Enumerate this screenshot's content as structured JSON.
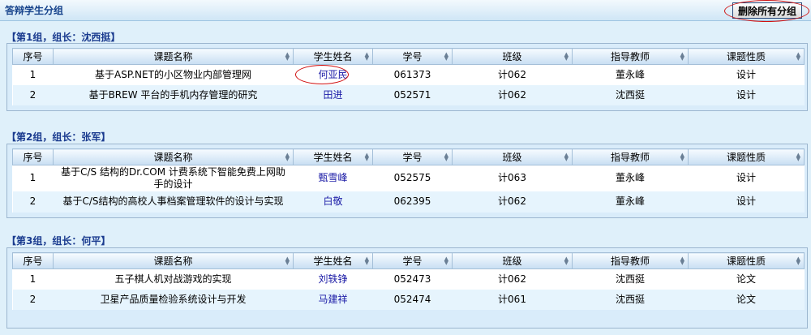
{
  "header": {
    "title": "答辩学生分组",
    "delete_all_label": "删除所有分组"
  },
  "columns": [
    "序号",
    "课题名称",
    "学生姓名",
    "学号",
    "班级",
    "指导教师",
    "课题性质"
  ],
  "groups": [
    {
      "title": "【第1组，组长：沈西挺】",
      "rows": [
        {
          "no": "1",
          "topic": "基于ASP.NET的小区物业内部管理网",
          "student": "何亚民",
          "id": "061373",
          "class": "计062",
          "teacher": "董永峰",
          "nature": "设计"
        },
        {
          "no": "2",
          "topic": "基于BREW 平台的手机内存管理的研究",
          "student": "田进",
          "id": "052571",
          "class": "计062",
          "teacher": "沈西挺",
          "nature": "设计"
        }
      ]
    },
    {
      "title": "【第2组，组长：张军】",
      "rows": [
        {
          "no": "1",
          "topic": "基于C/S 结构的Dr.COM 计费系统下智能免费上网助手的设计",
          "student": "甄雪峰",
          "id": "052575",
          "class": "计063",
          "teacher": "董永峰",
          "nature": "设计"
        },
        {
          "no": "2",
          "topic": "基于C/S结构的高校人事档案管理软件的设计与实现",
          "student": "白敬",
          "id": "062395",
          "class": "计062",
          "teacher": "董永峰",
          "nature": "设计"
        }
      ]
    },
    {
      "title": "【第3组，组长：何平】",
      "rows": [
        {
          "no": "1",
          "topic": "五子棋人机对战游戏的实现",
          "student": "刘轶铮",
          "id": "052473",
          "class": "计062",
          "teacher": "沈西挺",
          "nature": "论文"
        },
        {
          "no": "2",
          "topic": "卫星产品质量检验系统设计与开发",
          "student": "马建祥",
          "id": "052474",
          "class": "计061",
          "teacher": "沈西挺",
          "nature": "论文"
        }
      ]
    }
  ]
}
